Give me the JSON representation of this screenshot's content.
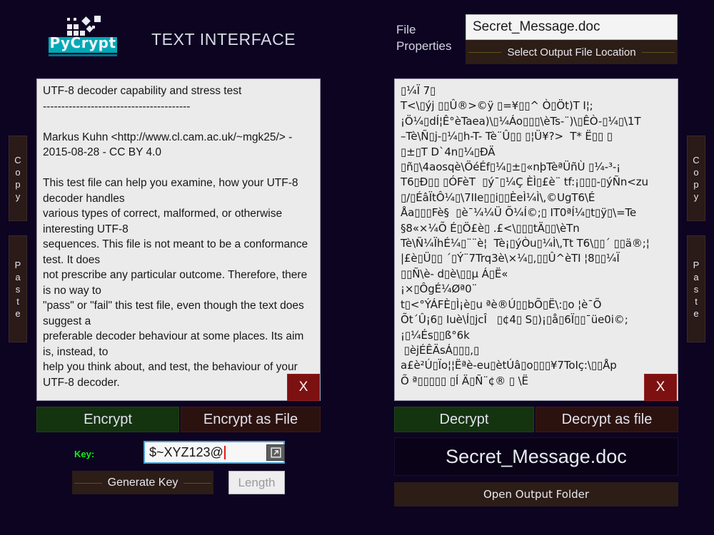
{
  "app": {
    "title": "TEXT INTERFACE",
    "logo_text": "PyCrypt",
    "bg_color": "#0d0422",
    "accent_color": "#00a9b5"
  },
  "file_properties": {
    "label": "File\nProperties",
    "filename_value": "Secret_Message.doc",
    "select_output_label": "Select Output File Location"
  },
  "left_side_buttons": {
    "copy_label": "Copy",
    "paste_label": "Paste"
  },
  "right_side_buttons": {
    "copy_label": "Copy",
    "paste_label": "Paste"
  },
  "plaintext_panel": {
    "content": "UTF-8 decoder capability and stress test\n----------------------------------------\n\nMarkus Kuhn <http://www.cl.cam.ac.uk/~mgk25/> - 2015-08-28 - CC BY 4.0\n\nThis test file can help you examine, how your UTF-8 decoder handles\nvarious types of correct, malformed, or otherwise interesting UTF-8\nsequences. This file is not meant to be a conformance test. It does\nnot prescribe any particular outcome. Therefore, there is no way to\n\"pass\" or \"fail\" this test file, even though the text does suggest a\npreferable decoder behaviour at some places. Its aim is, instead, to\nhelp you think about, and test, the behaviour of your UTF-8 decoder.",
    "clear_label": "X"
  },
  "ciphertext_panel": {
    "content": "▯¼Ï 7▯\nT<\\▯ýj ▯▯Û®>©ÿ ▯=¥▯▯^ Ò▯Öt)T I¦;\n¡Ö¼▯dÍ¦Ê°èTaea)\\▯¼Áo▯▯▯\\èTs-¨)\\▯ÊÒ-▯¼▯\\1T\n–Tè\\Ñ▯j-▯¼▯h-T- Tè¨Û▯▯ ▯¦Ü¥?>  T* Ë▯▯ ▯\n▯±▯T D`4n▯¼▯ÐÄ\n▯ñ▯\\4aosqè\\ÖéÉf▯¼▯±▯«nþTèªÜñÙ ▯¼-³-¡\nT6▯Ð▯▯ ▯ÓFèT  ▯ý¯▯¼Ç ÈÌ▯£è¨ tf:¡▯▯▯-▯ýÑn<zu\n▯/▯ÉâÏtÔ¼▯\\7IIe▯▯i▯▯ÈeÌ¼Ì\\,©UgT6\\É\nÅa▯▯▯Fè§  ▯è¯¼¼Ü Õ¼Í©;▯ IT0ªÍ¼▯t▯ÿ▯\\=Te\n§8«×¼Õ É▯Ö£è▯ .£<\\▯▯▯tÄ▯▯\\èTn\nTè\\Ñ¼ÏhÉ¼▯¨¨è¦  Tè¡▯ýÒu▯¼Ì\\,Tt T6\\▯▯´ ▯▯ä®;¦\n|£è▯Ü▯▯ ´▯Ý¨7Trq3è\\×¼▯,▯▯Û^èTI ¦8▯▯¼Ï\n▯▯Ñ\\è- d▯è\\▯▯µ Á▯Ë«\n¡×▯ÔgÉ¼Øª0¨\nt▯<°ÝÁFÈ▯Ì¡è▯u ªè®Ú▯▯bÕ▯Ë\\:▯o ¦è¯Õ\nÕt´Û¡6▯ Iuè\\Í▯jcÎ   ▯¢4▯ S▯)¡▯å▯6Ï▯▯¯üe0i©;\n¡▯¼És▯▯ß°6k\n ▯èjÉÊÄsÁ▯▯▯,▯\na£è²Ú▯Ïo¦¦Ëªè-eu▯ètÚâ▯o▯▯▯¥7ToIç:\\▯▯Åp\nÕ ª▯▯▯▯▯ ▯Í Ä▯Ñ¨¢® ▯ \\Ë",
    "clear_label": "X"
  },
  "left_actions": {
    "encrypt_label": "Encrypt",
    "encrypt_as_file_label": "Encrypt as File"
  },
  "right_actions": {
    "decrypt_label": "Decrypt",
    "decrypt_as_file_label": "Decrypt as file"
  },
  "key_row": {
    "key_label": "Key:",
    "key_value": "$~XYZ123@",
    "generate_key_label": "Generate Key",
    "length_placeholder": "Length",
    "expand_icon": "external-link-icon"
  },
  "output": {
    "filename": "Secret_Message.doc",
    "open_folder_label": "Open Output Folder"
  }
}
